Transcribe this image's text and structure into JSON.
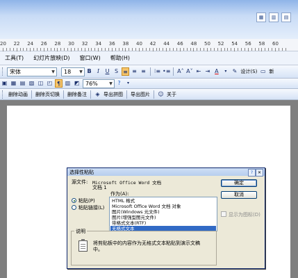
{
  "window": {
    "title_icons": [
      "slide-sorter-icon",
      "normal-view-icon",
      "grid-icon"
    ]
  },
  "ruler": {
    "numbers": [
      "20",
      "22",
      "24",
      "26",
      "28",
      "30",
      "32",
      "34",
      "36",
      "38",
      "40",
      "42",
      "44",
      "46",
      "48",
      "50",
      "52",
      "54",
      "56",
      "58",
      "60"
    ]
  },
  "menubar": {
    "items": [
      "工具(T)",
      "幻灯片放映(D)",
      "窗口(W)",
      "帮助(H)"
    ]
  },
  "toolbar1": {
    "font_name": "宋体",
    "font_size": "18",
    "design_label": "设计(S)",
    "new_slide_label": "新"
  },
  "toolbar2": {
    "zoom": "76%"
  },
  "toolbar3": {
    "items": [
      "删除动画",
      "删除页切换",
      "删除备注",
      "导出拼图",
      "导出图片",
      "关于"
    ]
  },
  "dialog": {
    "title": "选择性粘贴",
    "source_label": "源文件:",
    "source_line1": "Microsoft Office Word 文档",
    "source_line2": "文档 1",
    "as_label": "作为(A):",
    "radio_paste": "粘贴(P)",
    "radio_paste_link": "粘贴链接(L)",
    "list_items": [
      "HTML 格式",
      "Microsoft Office Word 文档 对象",
      "图片(Windows 元文件)",
      "图片(增强型图元文件)",
      "带格式文本(RTF)",
      "无格式文本"
    ],
    "selected_index": 5,
    "ok_button": "确定",
    "cancel_button": "取消",
    "display_as_icon": "显示为图标(D)",
    "explain_title": "说明",
    "explain_text_line1": "将剪贴板中的内容作为无格式文本粘贴到演示文稿",
    "explain_text_line2": "中。"
  },
  "colors": {
    "title_gradient": "#8fb4e8",
    "list_selection": "#316ac5",
    "dialog_bg": "#ece9d8",
    "workspace": "#7f7f7f"
  }
}
